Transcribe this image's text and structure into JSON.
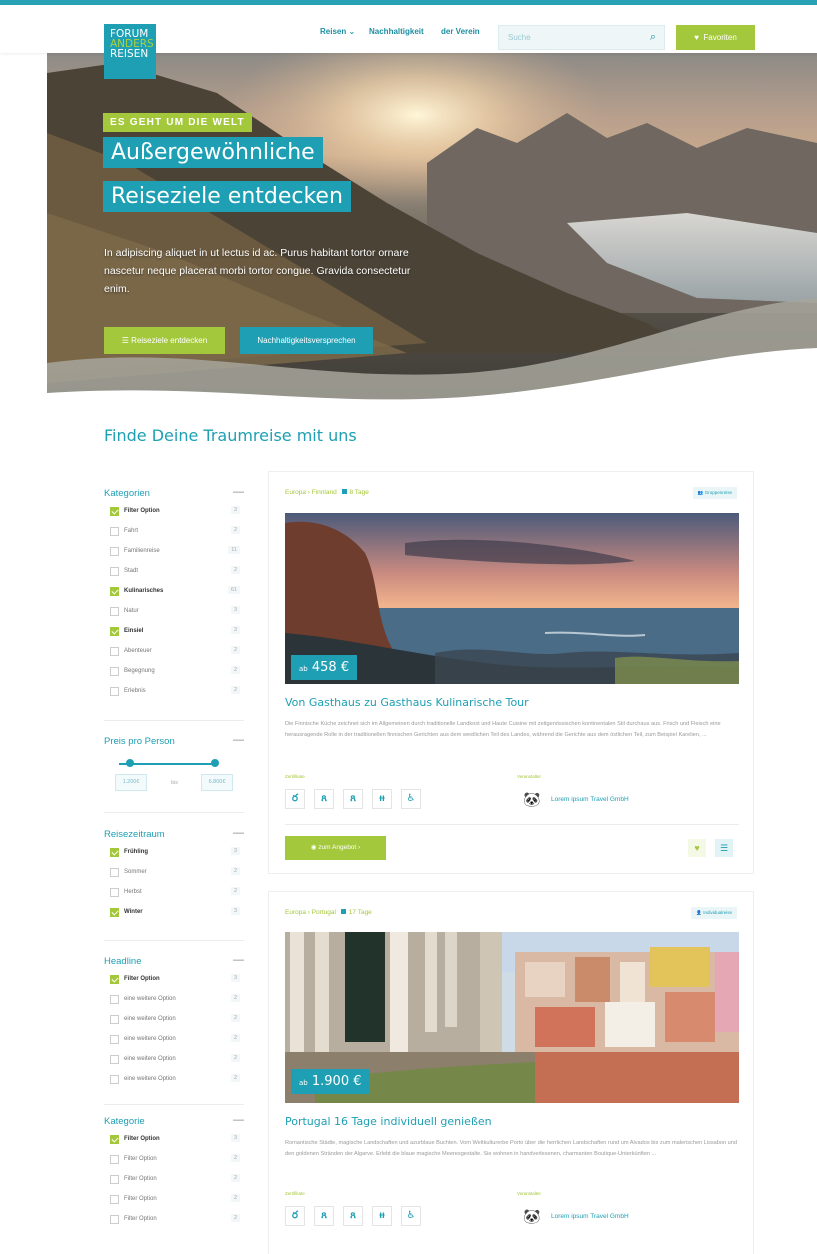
{
  "header": {
    "logo": [
      "FORUM",
      "ANDERS",
      "REISEN"
    ],
    "nav": [
      "Reisen ⌄",
      "Nachhaltigkeit",
      "der Verein"
    ],
    "search_placeholder": "Suche",
    "favorites_label": "Favoriten"
  },
  "hero": {
    "tagline": "ES GEHT UM DIE WELT",
    "headline_1": "Außergewöhnliche",
    "headline_2": "Reiseziele entdecken",
    "intro": "In adipiscing aliquet in ut lectus id ac. Purus habitant tortor ornare nascetur neque placerat morbi tortor congue. Gravida consectetur enim.",
    "btn_primary": "☰  Reiseziele entdecken",
    "btn_secondary": "Nachhaltigkeitsversprechen"
  },
  "section_title": "Finde Deine Traumreise mit uns",
  "filters": {
    "kategorien": {
      "title": "Kategorien",
      "items": [
        {
          "label": "Filter Option",
          "checked": true,
          "count": "3"
        },
        {
          "label": "Fahrt",
          "checked": false,
          "count": "2"
        },
        {
          "label": "Familienreise",
          "checked": false,
          "count": "11"
        },
        {
          "label": "Stadt",
          "checked": false,
          "count": "2"
        },
        {
          "label": "Kulinarisches",
          "checked": true,
          "count": "61"
        },
        {
          "label": "Natur",
          "checked": false,
          "count": "3"
        },
        {
          "label": "Einsiel",
          "checked": true,
          "count": "3"
        },
        {
          "label": "Abenteuer",
          "checked": false,
          "count": "2"
        },
        {
          "label": "Begegnung",
          "checked": false,
          "count": "2"
        },
        {
          "label": "Erlebnis",
          "checked": false,
          "count": "2"
        }
      ]
    },
    "preis": {
      "title": "Preis pro Person",
      "min": "1.200€",
      "separator": "bis",
      "max": "6.800€"
    },
    "reisezeitraum": {
      "title": "Reisezeitraum",
      "items": [
        {
          "label": "Frühling",
          "checked": true,
          "count": "3"
        },
        {
          "label": "Sommer",
          "checked": false,
          "count": "2"
        },
        {
          "label": "Herbst",
          "checked": false,
          "count": "2"
        },
        {
          "label": "Winter",
          "checked": true,
          "count": "3"
        }
      ]
    },
    "headline": {
      "title": "Headline",
      "items": [
        {
          "label": "Filter Option",
          "checked": true,
          "count": "3"
        },
        {
          "label": "eine weitere Option",
          "checked": false,
          "count": "2"
        },
        {
          "label": "eine weitere Option",
          "checked": false,
          "count": "2"
        },
        {
          "label": "eine weitere Option",
          "checked": false,
          "count": "2"
        },
        {
          "label": "eine weitere Option",
          "checked": false,
          "count": "2"
        },
        {
          "label": "eine weitere Option",
          "checked": false,
          "count": "2"
        }
      ]
    },
    "kategorie": {
      "title": "Kategorie",
      "items": [
        {
          "label": "Filter Option",
          "checked": true,
          "count": "3"
        },
        {
          "label": "Filter Option",
          "checked": false,
          "count": "2"
        },
        {
          "label": "Filter Option",
          "checked": false,
          "count": "2"
        },
        {
          "label": "Filter Option",
          "checked": false,
          "count": "2"
        },
        {
          "label": "Filter Option",
          "checked": false,
          "count": "2"
        }
      ]
    }
  },
  "cards": [
    {
      "crumb_region": "Europa",
      "crumb_country": "Finnland",
      "crumb_days": "8 Tage",
      "tag": "Gruppenreise",
      "price_prefix": "ab",
      "price": "458 €",
      "title": "Von Gasthaus zu Gasthaus Kulinarische Tour",
      "description": "Die Finnische Küche zeichnet sich im Allgemeinen durch traditionelle Landkost und Haute Cuisine mit zeitgenössischen kontinentalen Stil durchaus aus. Frisch und Fleisch eine herausragende Rolle in der traditionellen finnischen Gerichten aus dem westlichen Teil des Landes, während die Gerichte aus dem östlichen Teil, zum Beispiel Karelien, ...",
      "highlights_label": "Zertifikate",
      "organizer_label": "Veranstalter",
      "organizer": "Lorem ipsum Travel GmbH",
      "offer_label": "zum Angebot  ›"
    },
    {
      "crumb_region": "Europa",
      "crumb_country": "Portugal",
      "crumb_days": "17 Tage",
      "tag": "Individualreise",
      "price_prefix": "ab",
      "price": "1.900 €",
      "title": "Portugal 16 Tage individuell genießen",
      "description": "Romantische Städte, magische Landschaften und azurblaue Buchten. Vom Weltkulturerbe Porto über die herrlichen Landschaften rund um Alvados bis zum malerischen Lissabon und den goldenen Stränden der Algarve. Erlebt die blaue magische Meeresgestalte. Sie wohnen in handverlesenen, charmanten Boutique-Unterkünften ...",
      "highlights_label": "Zertifikate",
      "organizer_label": "Veranstalter",
      "organizer": "Lorem ipsum Travel GmbH"
    }
  ],
  "icons": [
    "bed-icon",
    "person-icon",
    "award-icon",
    "cutlery-icon",
    "accessible-icon"
  ],
  "colors": {
    "teal": "#1e9fb3",
    "green": "#a4c83b"
  }
}
